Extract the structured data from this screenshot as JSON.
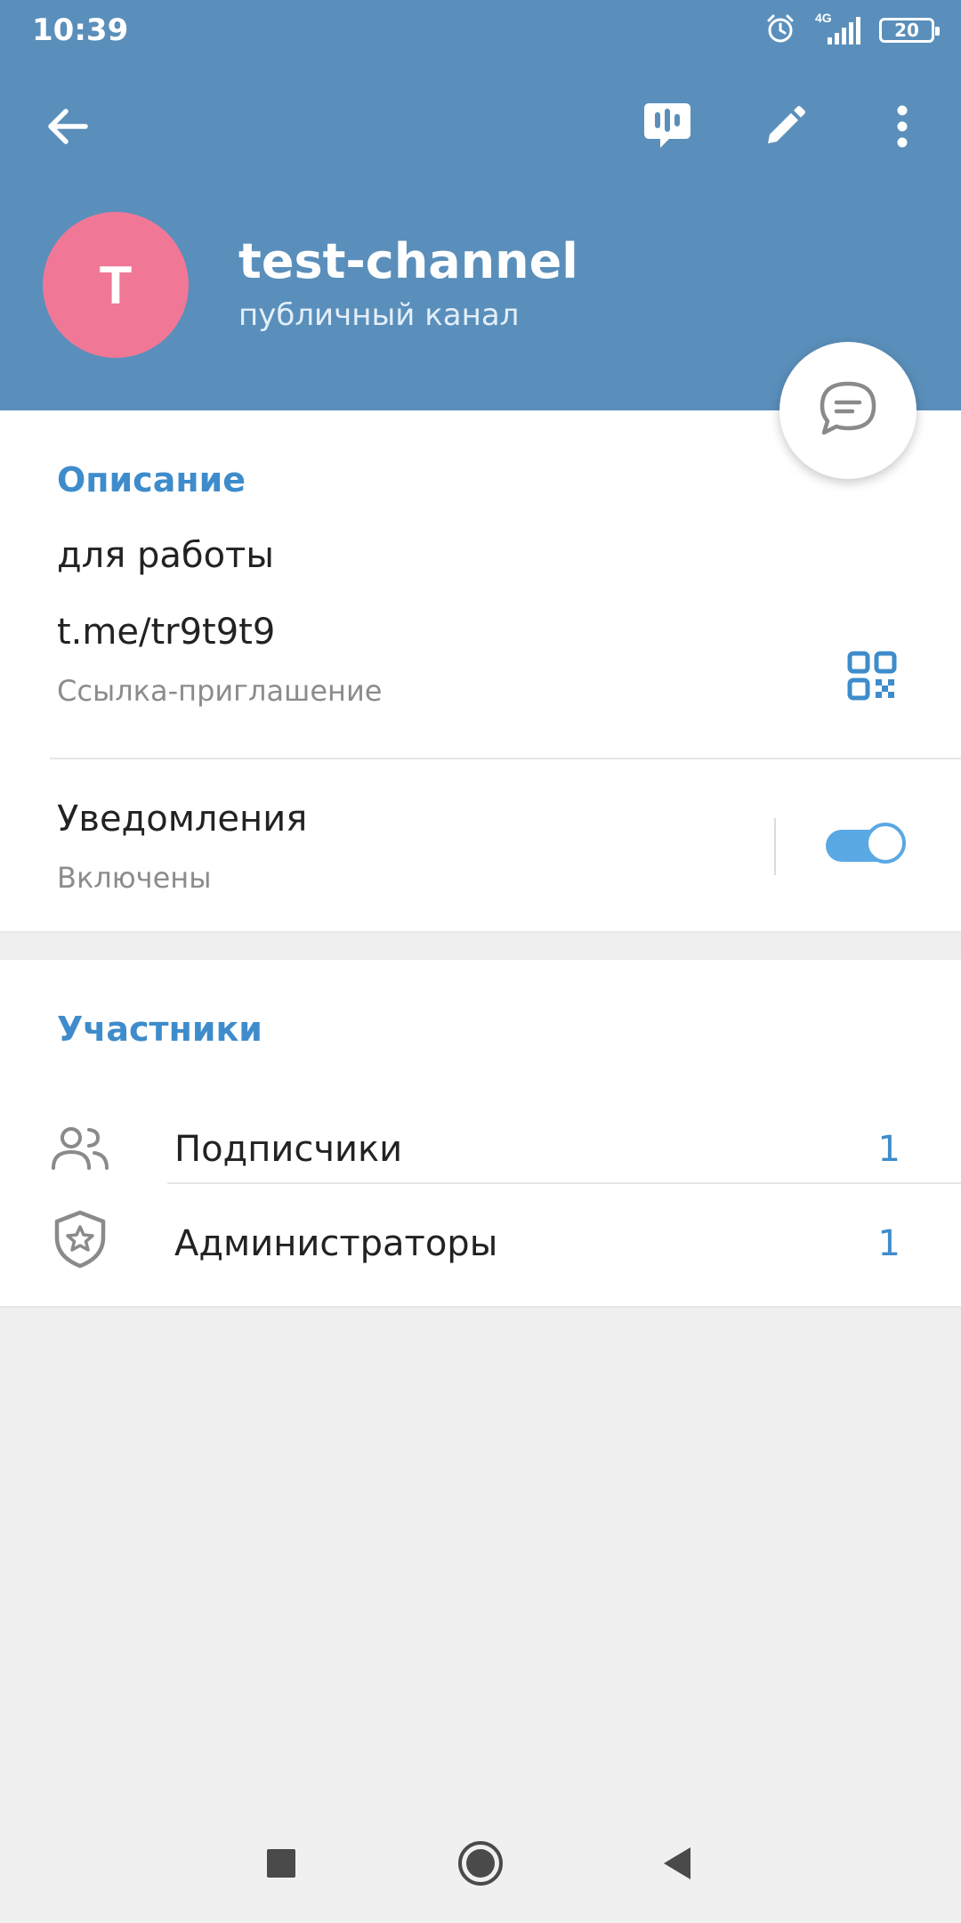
{
  "status_bar": {
    "time": "10:39",
    "network": "4G",
    "battery": "20"
  },
  "header": {
    "back_icon": "arrow-left-icon",
    "actions": [
      "live-stream-icon",
      "edit-icon",
      "more-vert-icon"
    ],
    "avatar_letter": "T",
    "avatar_color": "#f07896",
    "title": "test-channel",
    "subtitle": "публичный канал",
    "background": "#5a8fbb"
  },
  "fab": {
    "icon": "discussion-icon"
  },
  "info": {
    "section_title": "Описание",
    "description": "для работы",
    "link": "t.me/tr9t9t9",
    "link_caption": "Ссылка-приглашение",
    "notifications_label": "Уведомления",
    "notifications_state": "Включены",
    "notifications_on": true
  },
  "members": {
    "section_title": "Участники",
    "rows": [
      {
        "label": "Подписчики",
        "count": "1",
        "icon": "people-icon"
      },
      {
        "label": "Администраторы",
        "count": "1",
        "icon": "admin-shield-icon"
      }
    ]
  },
  "accent_color": "#3e8ccb"
}
